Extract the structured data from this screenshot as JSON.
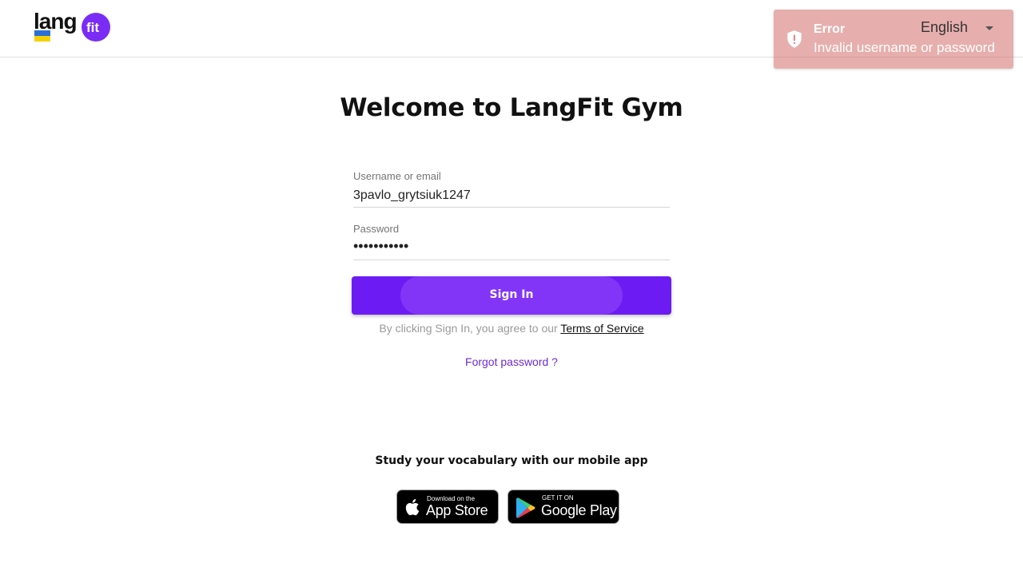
{
  "header": {
    "logo_text": "lang",
    "logo_fit": "fit",
    "language": "English"
  },
  "toast": {
    "title": "Error",
    "message": "Invalid username or password"
  },
  "main": {
    "title": "Welcome to LangFit Gym",
    "username_label": "Username or email",
    "username_value": "3pavlo_grytsiuk1247",
    "password_label": "Password",
    "password_value": "•••••••••••",
    "signin_label": "Sign In",
    "terms_prefix": "By clicking Sign In, you agree to our ",
    "terms_link": "Terms of Service",
    "forgot_link": "Forgot password ?"
  },
  "promo": {
    "text": "Study your vocabulary with our mobile app",
    "app_store_small": "Download on the",
    "app_store_big": "App Store",
    "google_small": "GET IT ON",
    "google_big": "Google Play"
  },
  "colors": {
    "brand": "#6c1cf2",
    "toast": "#e0a8a5",
    "flag_blue": "#2c6fd6",
    "flag_yellow": "#f6d100"
  },
  "icons": [
    "shield-alert-icon",
    "chevron-down-icon",
    "apple-icon",
    "google-play-icon",
    "ukraine-flag-icon"
  ]
}
